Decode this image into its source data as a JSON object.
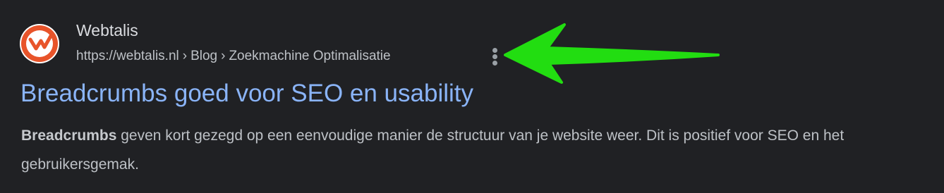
{
  "result": {
    "site_name": "Webtalis",
    "favicon_icon": "webtalis-logo-icon",
    "breadcrumb": {
      "url": "https://webtalis.nl",
      "separator": "›",
      "segments": [
        "Blog",
        "Zoekmachine Optimalisatie"
      ]
    },
    "more_icon": "three-dots-vertical-icon",
    "title": "Breadcrumbs goed voor SEO en usability",
    "snippet": {
      "highlight": "Breadcrumbs",
      "rest": " geven kort gezegd op een eenvoudige manier de structuur van je website weer. Dit is positief voor SEO en het gebruikersgemak."
    }
  },
  "annotation": {
    "arrow_icon": "green-arrow-annotation",
    "arrow_color": "#22dd11"
  },
  "colors": {
    "background": "#202124",
    "title_link": "#8ab4f8",
    "site_name": "#dadce0",
    "secondary_text": "#bdc1c6",
    "logo_orange": "#e8542a"
  }
}
